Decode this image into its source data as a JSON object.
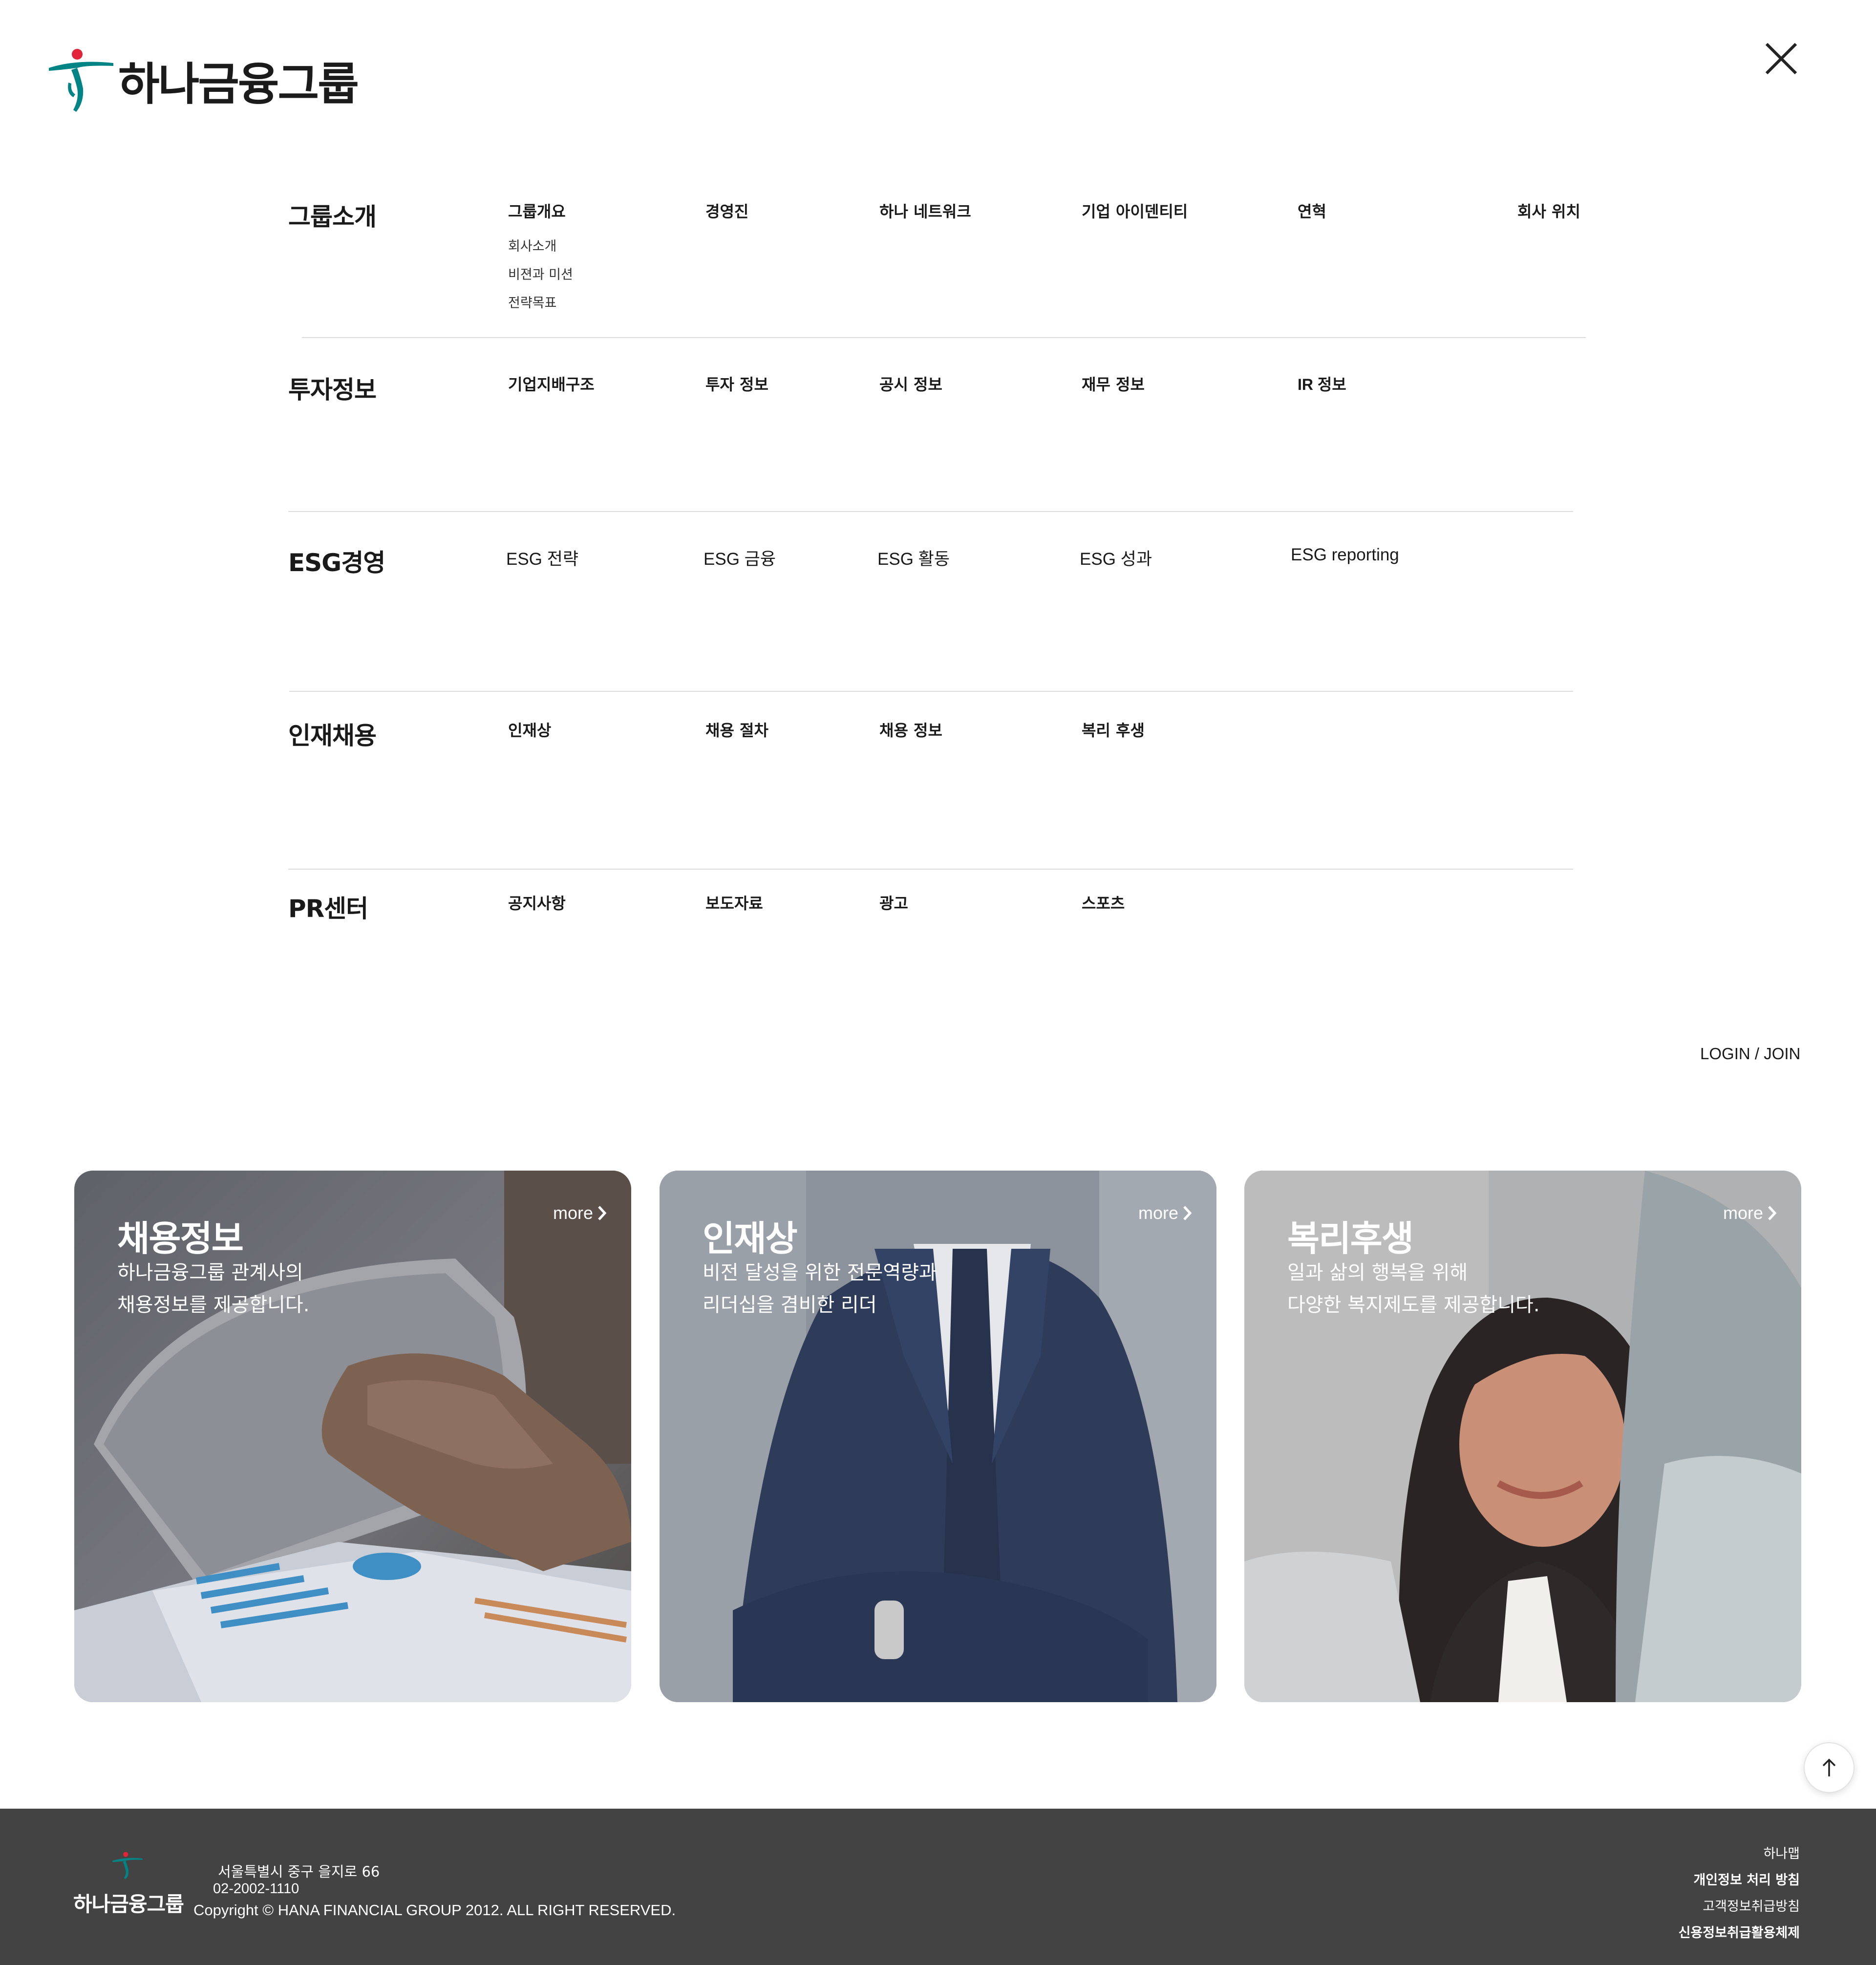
{
  "header": {
    "logo_text": "하나금융그룹",
    "close_icon": "close-icon"
  },
  "menu": [
    {
      "title": "그룹소개",
      "items": [
        "그룹개요",
        "경영진",
        "하나 네트워크",
        "기업 아이덴티티",
        "연혁",
        "회사 위치"
      ],
      "subitems": [
        "회사소개",
        "비젼과 미션",
        "전략목표"
      ]
    },
    {
      "title": "투자정보",
      "items": [
        "기업지배구조",
        "투자 정보",
        "공시 정보",
        "재무 정보",
        "IR 정보"
      ]
    },
    {
      "title": "ESG경영",
      "items": [
        "ESG 전략",
        "ESG 금융",
        "ESG 활동",
        "ESG 성과",
        "ESG reporting"
      ]
    },
    {
      "title": "인재채용",
      "items": [
        "인재상",
        "채용 절차",
        "채용 정보",
        "복리 후생"
      ]
    },
    {
      "title": "PR센터",
      "items": [
        "공지사항",
        "보도자료",
        "광고",
        "스포츠"
      ]
    }
  ],
  "login_label": "LOGIN / JOIN",
  "cards": [
    {
      "title": "채용정보",
      "desc": "하나금융그룹 관계사의\n채용정보를 제공합니다.",
      "more": "more"
    },
    {
      "title": "인재상",
      "desc": "비전 달성을 위한 전문역량과\n리더십을 겸비한 리더",
      "more": "more"
    },
    {
      "title": "복리후생",
      "desc": "일과 삶의 행복을 위해\n다양한 복지제도를 제공합니다.",
      "more": "more"
    }
  ],
  "footer": {
    "logo_text": "하나금융그룹",
    "address": "서울특별시 중구 을지로 66",
    "phone": "02-2002-1110",
    "copyright": "Copyright © HANA FINANCIAL GROUP 2012. ALL RIGHT RESERVED.",
    "links": [
      "하나맵",
      "개인정보 처리 방침",
      "고객정보취급방침",
      "신용정보취급활용체제"
    ]
  },
  "colors": {
    "brand_green": "#008485",
    "brand_red": "#e1243a",
    "footer_bg": "#434343"
  }
}
